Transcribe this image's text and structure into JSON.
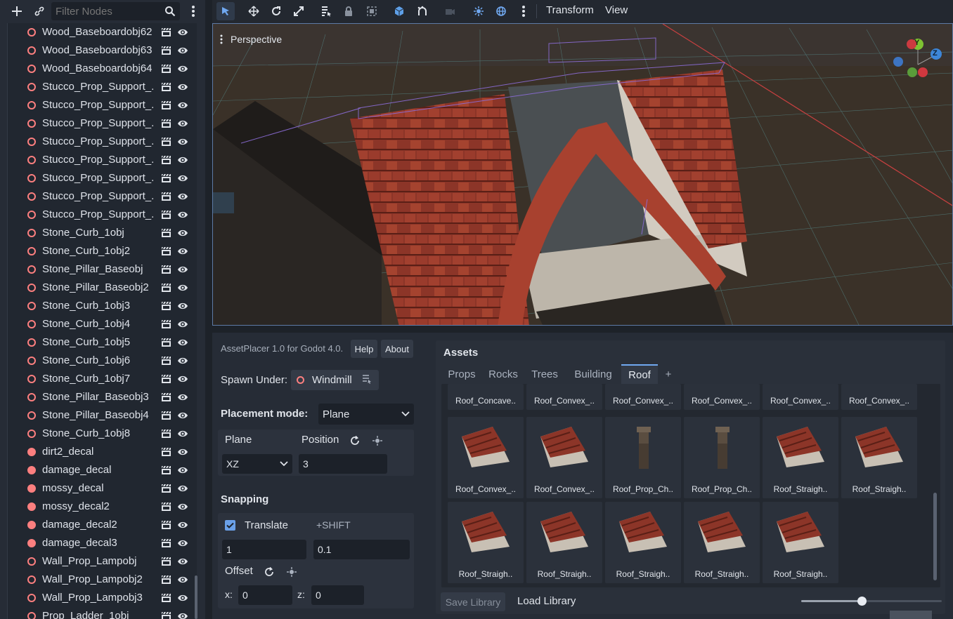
{
  "scene_panel": {
    "filter_placeholder": "Filter Nodes",
    "nodes": [
      {
        "name": "Wood_Baseboardobj62",
        "type": "scene"
      },
      {
        "name": "Wood_Baseboardobj63",
        "type": "scene"
      },
      {
        "name": "Wood_Baseboardobj64",
        "type": "scene"
      },
      {
        "name": "Stucco_Prop_Support_...",
        "type": "scene"
      },
      {
        "name": "Stucco_Prop_Support_...",
        "type": "scene"
      },
      {
        "name": "Stucco_Prop_Support_...",
        "type": "scene"
      },
      {
        "name": "Stucco_Prop_Support_...",
        "type": "scene"
      },
      {
        "name": "Stucco_Prop_Support_...",
        "type": "scene"
      },
      {
        "name": "Stucco_Prop_Support_...",
        "type": "scene"
      },
      {
        "name": "Stucco_Prop_Support_...",
        "type": "scene"
      },
      {
        "name": "Stucco_Prop_Support_...",
        "type": "scene"
      },
      {
        "name": "Stone_Curb_1obj",
        "type": "scene"
      },
      {
        "name": "Stone_Curb_1obj2",
        "type": "scene"
      },
      {
        "name": "Stone_Pillar_Baseobj",
        "type": "scene"
      },
      {
        "name": "Stone_Pillar_Baseobj2",
        "type": "scene"
      },
      {
        "name": "Stone_Curb_1obj3",
        "type": "scene"
      },
      {
        "name": "Stone_Curb_1obj4",
        "type": "scene"
      },
      {
        "name": "Stone_Curb_1obj5",
        "type": "scene"
      },
      {
        "name": "Stone_Curb_1obj6",
        "type": "scene"
      },
      {
        "name": "Stone_Curb_1obj7",
        "type": "scene"
      },
      {
        "name": "Stone_Pillar_Baseobj3",
        "type": "scene"
      },
      {
        "name": "Stone_Pillar_Baseobj4",
        "type": "scene"
      },
      {
        "name": "Stone_Curb_1obj8",
        "type": "scene"
      },
      {
        "name": "dirt2_decal",
        "type": "decal"
      },
      {
        "name": "damage_decal",
        "type": "decal"
      },
      {
        "name": "mossy_decal",
        "type": "decal"
      },
      {
        "name": "mossy_decal2",
        "type": "decal"
      },
      {
        "name": "damage_decal2",
        "type": "decal"
      },
      {
        "name": "damage_decal3",
        "type": "decal"
      },
      {
        "name": "Wall_Prop_Lampobj",
        "type": "scene"
      },
      {
        "name": "Wall_Prop_Lampobj2",
        "type": "scene"
      },
      {
        "name": "Wall_Prop_Lampobj3",
        "type": "scene"
      },
      {
        "name": "Prop_Ladder_1obj",
        "type": "scene"
      }
    ]
  },
  "toolbar": {
    "transform_menu": "Transform",
    "view_menu": "View"
  },
  "viewport": {
    "mode_label": "Perspective",
    "gizmo": {
      "y": "Y",
      "z": "Z"
    }
  },
  "asset_placer": {
    "title": "AssetPlacer 1.0 for Godot 4.0.",
    "help_button": "Help",
    "about_button": "About",
    "spawn_under_label": "Spawn Under:",
    "spawn_under_value": "Windmill",
    "placement_mode_label": "Placement mode:",
    "placement_mode_value": "Plane",
    "plane_label": "Plane",
    "plane_value": "XZ",
    "position_label": "Position",
    "position_value": "3",
    "snapping_label": "Snapping",
    "translate_label": "Translate",
    "translate_checked": true,
    "shift_label": "+SHIFT",
    "translate_value": "1",
    "shift_value": "0.1",
    "offset_label": "Offset",
    "offset_x_label": "x:",
    "offset_x_value": "0",
    "offset_z_label": "z:",
    "offset_z_value": "0"
  },
  "assets": {
    "title": "Assets",
    "tabs": [
      "Props",
      "Rocks",
      "Trees",
      "Building",
      "Roof",
      "+"
    ],
    "active_tab": "Roof",
    "row1": [
      "Roof_Concave..",
      "Roof_Convex_..",
      "Roof_Convex_..",
      "Roof_Convex_..",
      "Roof_Convex_..",
      "Roof_Convex_.."
    ],
    "row2": [
      "Roof_Convex_..",
      "Roof_Convex_..",
      "Roof_Prop_Ch..",
      "Roof_Prop_Ch..",
      "Roof_Straigh..",
      "Roof_Straigh.."
    ],
    "row3": [
      "Roof_Straigh..",
      "Roof_Straigh..",
      "Roof_Straigh..",
      "Roof_Straigh..",
      "Roof_Straigh.."
    ],
    "save_library": "Save Library",
    "load_library": "Load Library",
    "zoom_fraction": 0.43
  },
  "colors": {
    "accent": "#70a8f0",
    "node_icon": "#fc7f7f",
    "roof": "#8c3528"
  }
}
